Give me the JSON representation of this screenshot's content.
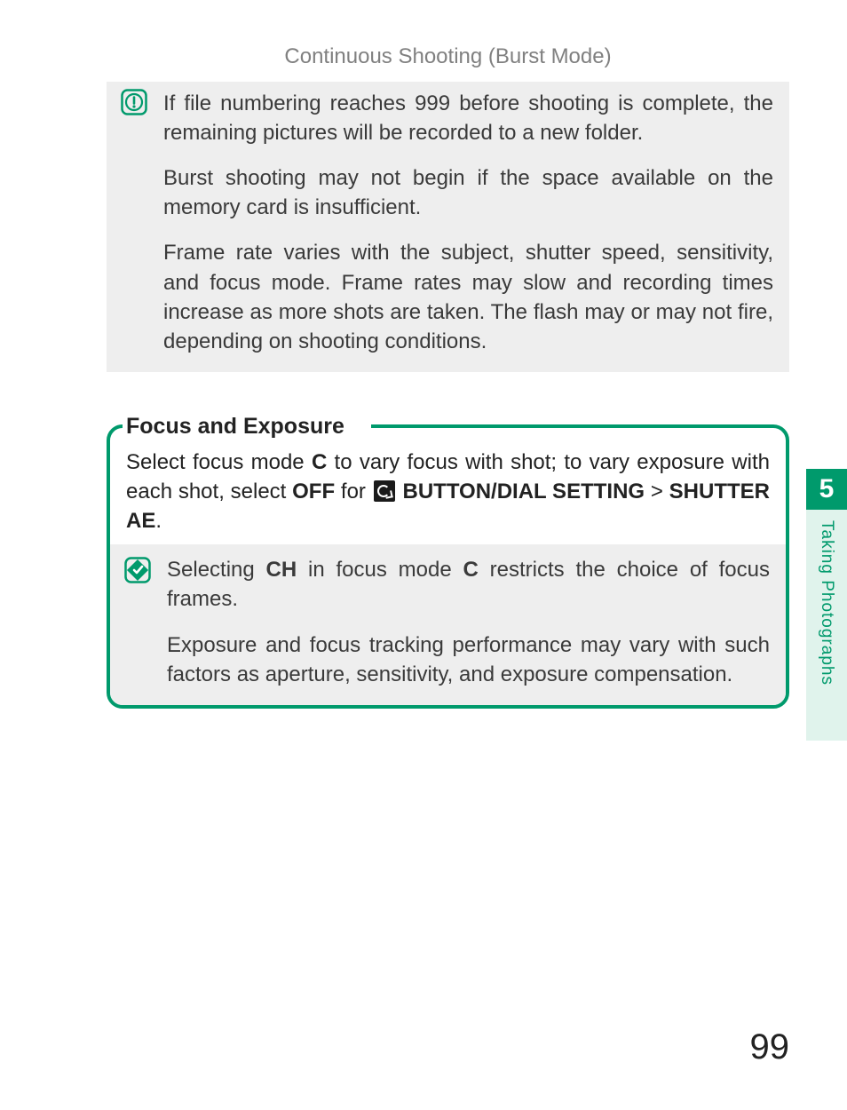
{
  "header": {
    "title": "Continuous Shooting (Burst Mode)"
  },
  "caution": {
    "p1": "If file numbering reaches 999 before shooting is complete, the remaining pictures will be recorded to a new folder.",
    "p2": "Burst shooting may not begin if the space available on the memory card is insufficient.",
    "p3": "Frame rate varies with the subject, shutter speed, sensitivity, and focus mode. Frame rates may slow and recording times increase as more shots are taken. The flash may or may not fire, depending on shooting conditions."
  },
  "focus_exposure": {
    "legend": "Focus and Exposure",
    "intro_pre": "Select focus mode ",
    "intro_c": "C",
    "intro_mid1": " to vary focus with shot; to vary exposure with each shot, select ",
    "intro_off": "OFF",
    "intro_mid2": " for ",
    "intro_menu": "BUTTON/DIAL SETTING",
    "intro_gt": " > ",
    "intro_shutter": "SHUTTER AE",
    "intro_end": ".",
    "note1_a": "Selecting ",
    "note1_ch": "CH",
    "note1_b": " in focus mode ",
    "note1_c": "C",
    "note1_d": " restricts the choice of focus frames.",
    "note2": "Exposure and focus tracking performance may vary with such factors as aperture, sensitivity, and exposure compensation."
  },
  "side": {
    "chapter": "5",
    "label": "Taking Photographs"
  },
  "page_number": "99"
}
